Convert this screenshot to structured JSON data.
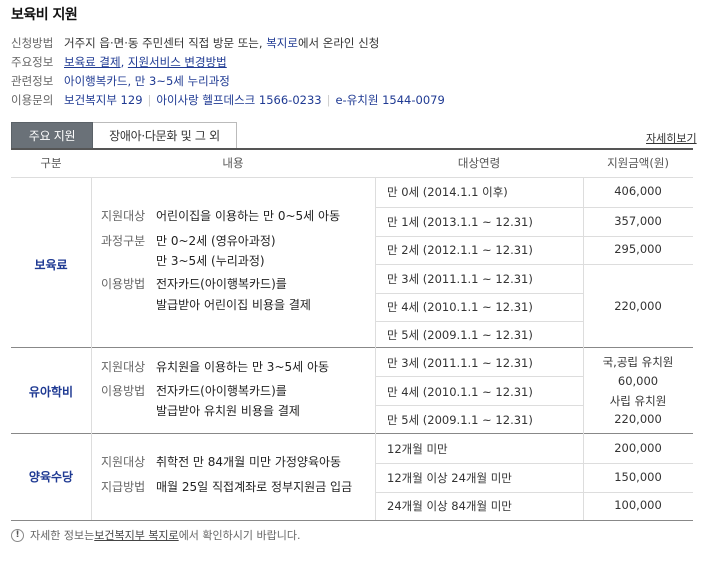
{
  "title": "보육비 지원",
  "info": {
    "apply": {
      "label": "신청방법",
      "text1": "거주지 읍·면·동 주민센터 직접 방문 또는, ",
      "link": "복지로",
      "text2": "에서 온라인 신청"
    },
    "main": {
      "label": "주요정보",
      "link1": "보육료 결제",
      "comma": ", ",
      "link2": "지원서비스 변경방법"
    },
    "related": {
      "label": "관련정보",
      "link": "아이행복카드, 만 3~5세 누리과정"
    },
    "contact": {
      "label": "이용문의",
      "c1": "보건복지부 129",
      "c2": "아이사랑 헬프데스크 1566-0233",
      "c3": "e-유치원 1544-0079"
    }
  },
  "tabs": {
    "active": "주요 지원",
    "other": "장애아·다문화 및 그 외"
  },
  "detail_link": "자세히보기",
  "headers": {
    "category": "구분",
    "content": "내용",
    "age": "대상연령",
    "amount": "지원금액(원)"
  },
  "sections": {
    "childcare": {
      "name": "보육료",
      "l1_label": "지원대상",
      "l1_text": "어린이집을 이용하는 만 0~5세 아동",
      "l2_label": "과정구분",
      "l2_text": "만 0~2세 (영유아과정)",
      "l3_text": "만 3~5세 (누리과정)",
      "l4_label": "이용방법",
      "l4_text": "전자카드(아이행복카드)를",
      "l5_text": "발급받아 어린이집 비용을 결제",
      "ages": [
        "만 0세 (2014.1.1 이후)",
        "만 1세 (2013.1.1 ~ 12.31)",
        "만 2세 (2012.1.1 ~ 12.31)",
        "만 3세 (2011.1.1 ~ 12.31)",
        "만 4세 (2010.1.1 ~ 12.31)",
        "만 5세 (2009.1.1 ~ 12.31)"
      ],
      "amounts": [
        "406,000",
        "357,000",
        "295,000",
        "220,000"
      ]
    },
    "kinder": {
      "name": "유아학비",
      "l1_label": "지원대상",
      "l1_text": "유치원을 이용하는 만 3~5세 아동",
      "l2_label": "이용방법",
      "l2_text": "전자카드(아이행복카드)를",
      "l3_text": "발급받아 유치원 비용을 결제",
      "ages": [
        "만 3세 (2011.1.1 ~ 12.31)",
        "만 4세 (2010.1.1 ~ 12.31)",
        "만 5세 (2009.1.1 ~ 12.31)"
      ],
      "amounts": [
        "국,공립 유치원",
        "60,000",
        "사립 유치원",
        "220,000"
      ]
    },
    "home": {
      "name": "양육수당",
      "l1_label": "지원대상",
      "l1_text": "취학전 만 84개월 미만 가정양육아동",
      "l2_label": "지급방법",
      "l2_text": "매월 25일 직접계좌로 정부지원금 입금",
      "ages": [
        "12개월 미만",
        "12개월 이상 24개월 미만",
        "24개월 이상 84개월 미만"
      ],
      "amounts": [
        "200,000",
        "150,000",
        "100,000"
      ]
    }
  },
  "footer": {
    "icon": "!",
    "t1": "자세한 정보는 ",
    "l1": "보건복지부 복지로",
    "t2": "에서 확인하시기 바랍니다."
  }
}
